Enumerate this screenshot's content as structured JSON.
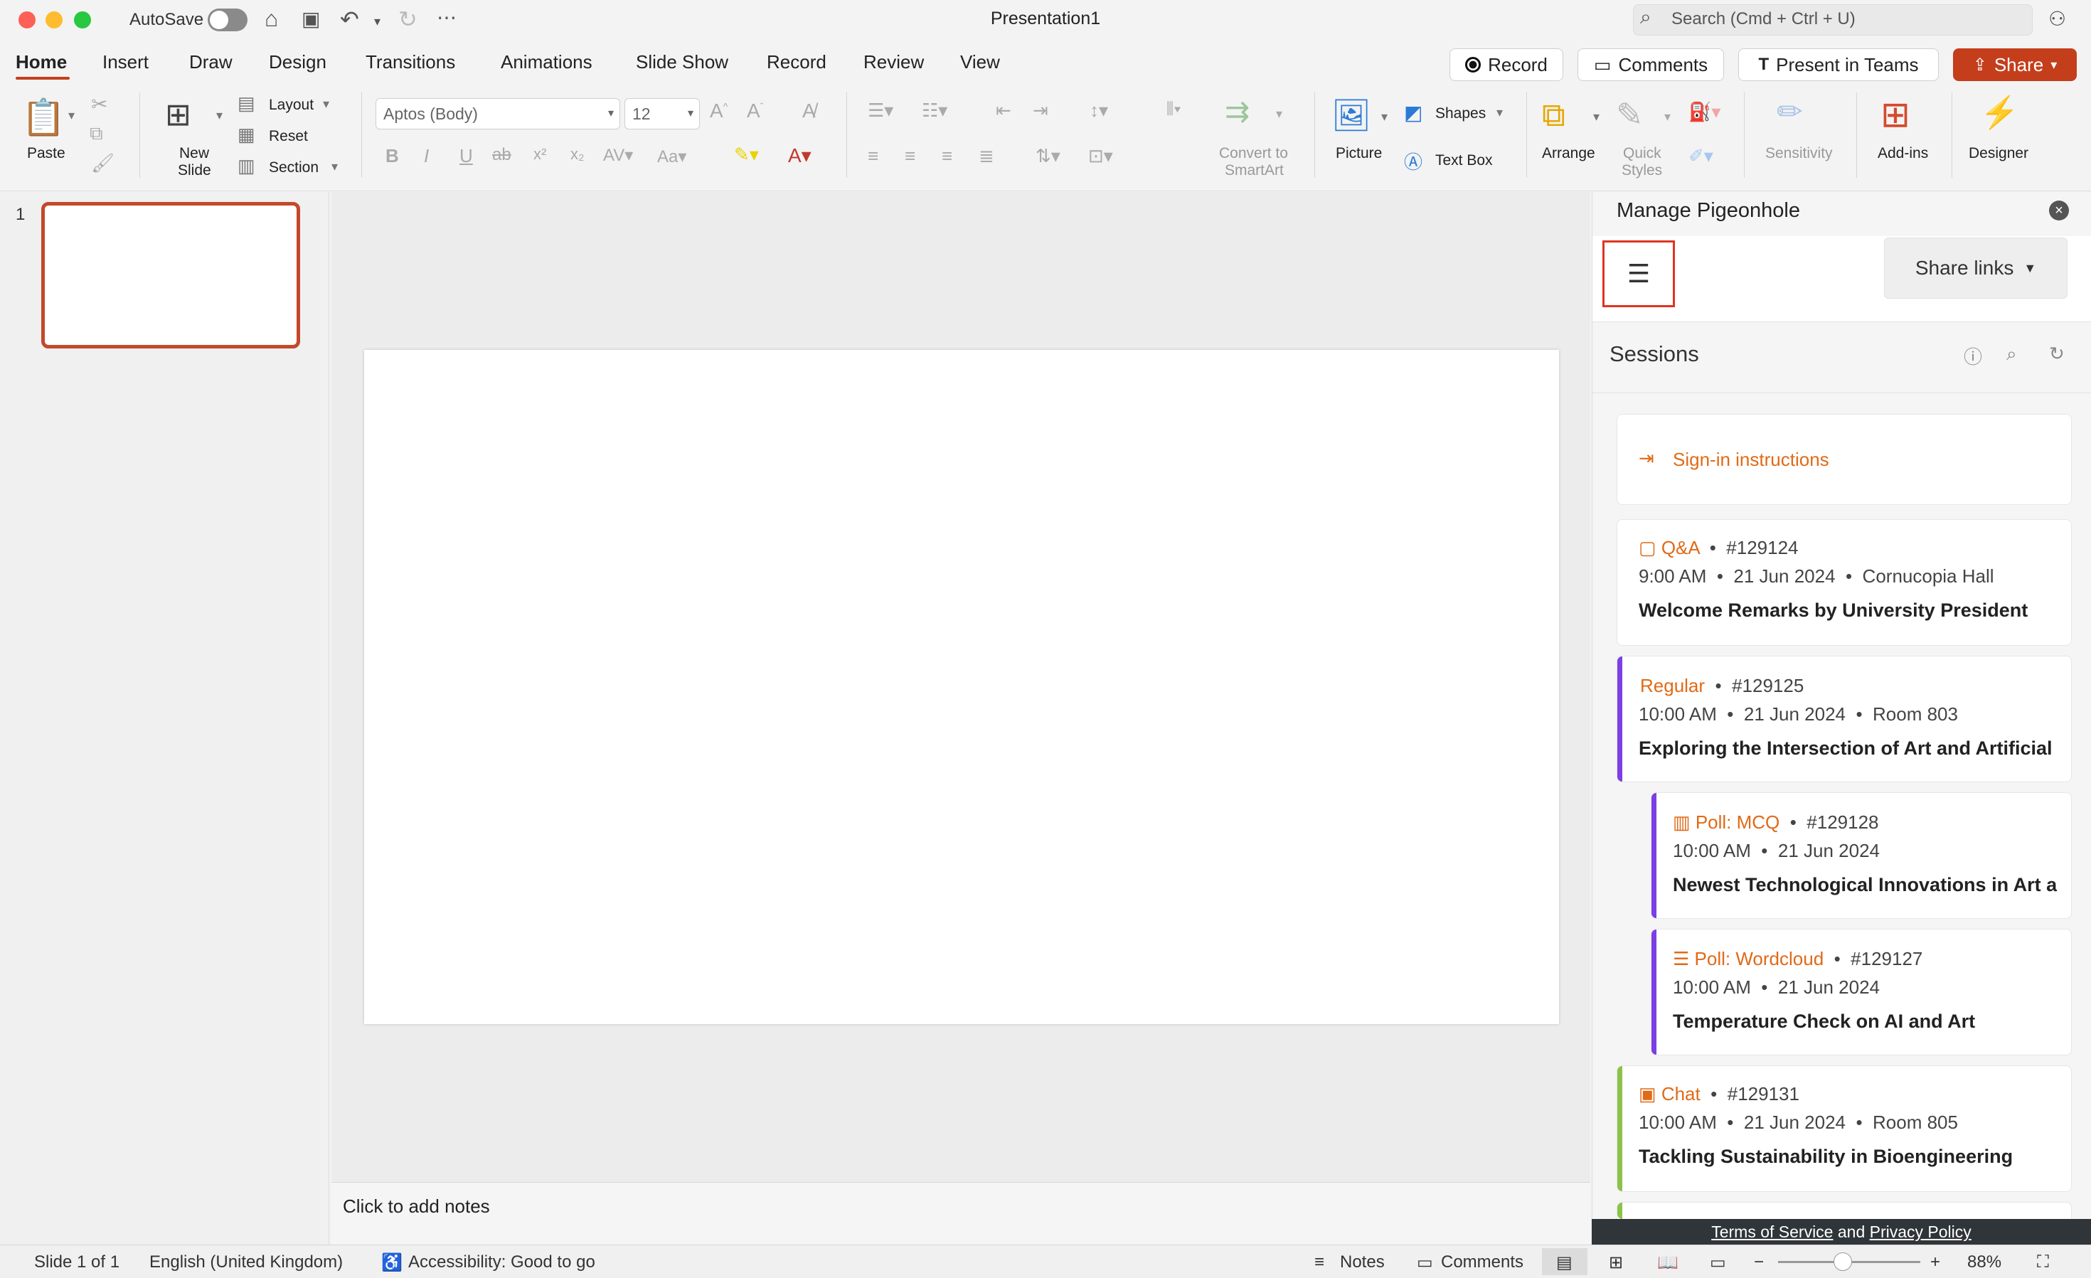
{
  "titlebar": {
    "autosave_label": "AutoSave",
    "document_title": "Presentation1",
    "search_placeholder": "Search (Cmd + Ctrl + U)"
  },
  "menu": {
    "tabs": [
      "Home",
      "Insert",
      "Draw",
      "Design",
      "Transitions",
      "Animations",
      "Slide Show",
      "Record",
      "Review",
      "View"
    ],
    "active_tab": "Home",
    "record_label": "Record",
    "comments_label": "Comments",
    "present_label": "Present in Teams",
    "share_label": "Share"
  },
  "ribbon": {
    "paste": "Paste",
    "new_slide_line1": "New",
    "new_slide_line2": "Slide",
    "layout": "Layout",
    "reset": "Reset",
    "section": "Section",
    "font_name": "Aptos (Body)",
    "font_size": "12",
    "convert_line1": "Convert to",
    "convert_line2": "SmartArt",
    "picture": "Picture",
    "shapes": "Shapes",
    "text_box": "Text Box",
    "arrange": "Arrange",
    "quick_styles_line1": "Quick",
    "quick_styles_line2": "Styles",
    "sensitivity": "Sensitivity",
    "addins": "Add-ins",
    "designer": "Designer"
  },
  "thumbnails": {
    "slide_number": "1"
  },
  "notes": {
    "placeholder": "Click to add notes"
  },
  "panel": {
    "title": "Manage Pigeonhole",
    "share_links": "Share links",
    "sessions_title": "Sessions",
    "signin": "Sign-in instructions",
    "sessions": [
      {
        "type": "Q&A",
        "id": "#129124",
        "time": "9:00 AM",
        "date": "21 Jun 2024",
        "venue": "Cornucopia Hall",
        "title": "Welcome Remarks by University President"
      },
      {
        "type": "Regular",
        "id": "#129125",
        "time": "10:00 AM",
        "date": "21 Jun 2024",
        "venue": "Room 803",
        "title": "Exploring the Intersection of Art and Artificial I"
      },
      {
        "type": "Poll: MCQ",
        "id": "#129128",
        "time": "10:00 AM",
        "date": "21 Jun 2024",
        "title": "Newest Technological Innovations in Art a"
      },
      {
        "type": "Poll: Wordcloud",
        "id": "#129127",
        "time": "10:00 AM",
        "date": "21 Jun 2024",
        "title": "Temperature Check on AI and Art"
      },
      {
        "type": "Chat",
        "id": "#129131",
        "time": "10:00 AM",
        "date": "21 Jun 2024",
        "venue": "Room 805",
        "title": "Tackling Sustainability in Bioengineering"
      }
    ],
    "footer_terms": "Terms of Service",
    "footer_and": " and ",
    "footer_privacy": "Privacy Policy"
  },
  "status": {
    "slide_info": "Slide 1 of 1",
    "language": "English (United Kingdom)",
    "accessibility": "Accessibility: Good to go",
    "notes": "Notes",
    "comments": "Comments",
    "zoom": "88%"
  },
  "colors": {
    "accent": "#c43e1c",
    "panel_type": "#e06a16",
    "purple": "#7b3fe4",
    "green": "#8bc34a"
  },
  "icons": [
    "home-icon",
    "save-icon",
    "undo-icon",
    "redo-icon",
    "more-icon",
    "search-icon",
    "close-icon",
    "menu-icon",
    "help-icon",
    "search-sessions-icon",
    "refresh-icon"
  ]
}
